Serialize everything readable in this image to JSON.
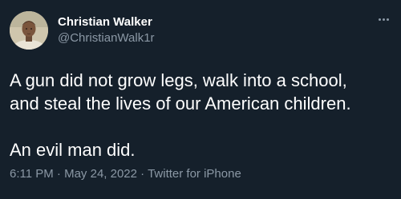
{
  "author": {
    "display_name": "Christian Walker",
    "handle": "@ChristianWalk1r",
    "avatar_icon": "profile-photo"
  },
  "more_icon": "more-horizontal-icon",
  "tweet": {
    "paragraphs": [
      "A gun did not grow legs, walk into a school,\nand steal the lives of our American children.",
      "An evil man did."
    ]
  },
  "meta": {
    "time": "6:11 PM",
    "separator": "·",
    "date": "May 24, 2022",
    "source": "Twitter for iPhone"
  },
  "colors": {
    "background": "#15202b",
    "text": "#ffffff",
    "secondary_text": "#8b98a5"
  }
}
